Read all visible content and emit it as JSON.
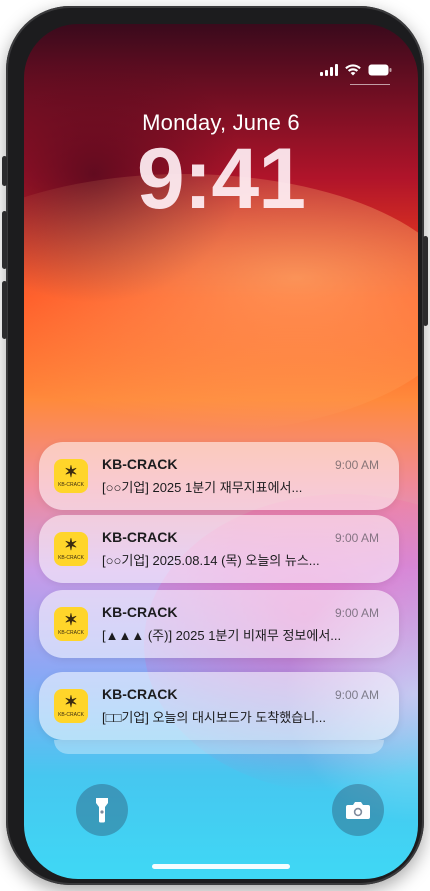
{
  "status_bar": {
    "icons": [
      "signal-icon",
      "wifi-icon",
      "battery-icon"
    ]
  },
  "lock_screen": {
    "date": "Monday, June 6",
    "time": "9:41"
  },
  "notifications": [
    {
      "app": "KB-CRACK",
      "time": "9:00 AM",
      "body": "[○○기업] 2025 1분기 재무지표에서...",
      "icon_label": "KB-CRACK"
    },
    {
      "app": "KB-CRACK",
      "time": "9:00 AM",
      "body": "[○○기업] 2025.08.14 (목) 오늘의 뉴스...",
      "icon_label": "KB-CRACK"
    },
    {
      "app": "KB-CRACK",
      "time": "9:00 AM",
      "body": "[▲▲▲ (주)] 2025 1분기 비재무 정보에서...",
      "icon_label": "KB-CRACK"
    },
    {
      "app": "KB-CRACK",
      "time": "9:00 AM",
      "body": "[□□기업] 오늘의 대시보드가 도착했습니...",
      "icon_label": "KB-CRACK"
    }
  ],
  "quick_actions": {
    "left": "flashlight-icon",
    "right": "camera-icon"
  },
  "colors": {
    "app_icon_bg": "#ffd52a",
    "notification_bg": "rgba(255,255,255,0.55)"
  }
}
